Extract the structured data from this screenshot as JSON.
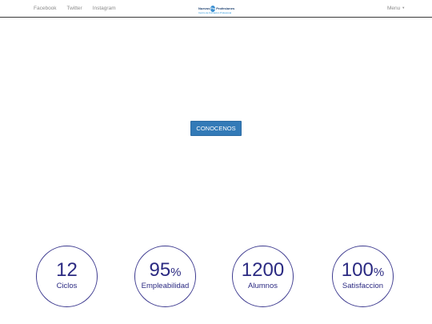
{
  "nav": {
    "social_links": [
      "Facebook",
      "Twitter",
      "Instagram"
    ],
    "menu_label": "Menu",
    "logo": {
      "word_left": "Nuevos",
      "badge": "Pro",
      "word_right": "Profesiones",
      "tagline": "Centro de Formación Profesional"
    }
  },
  "hero": {
    "button_label": "CONOCENOS"
  },
  "stats": [
    {
      "value": "12",
      "unit": "",
      "label": "Ciclos"
    },
    {
      "value": "95",
      "unit": "%",
      "label": "Empleabilidad"
    },
    {
      "value": "1200",
      "unit": "",
      "label": "Alumnos"
    },
    {
      "value": "100",
      "unit": "%",
      "label": "Satisfaccion"
    }
  ],
  "colors": {
    "primary_button": "#337ab7",
    "stat_accent": "#2b2a82",
    "nav_text": "#8c8c8c"
  }
}
